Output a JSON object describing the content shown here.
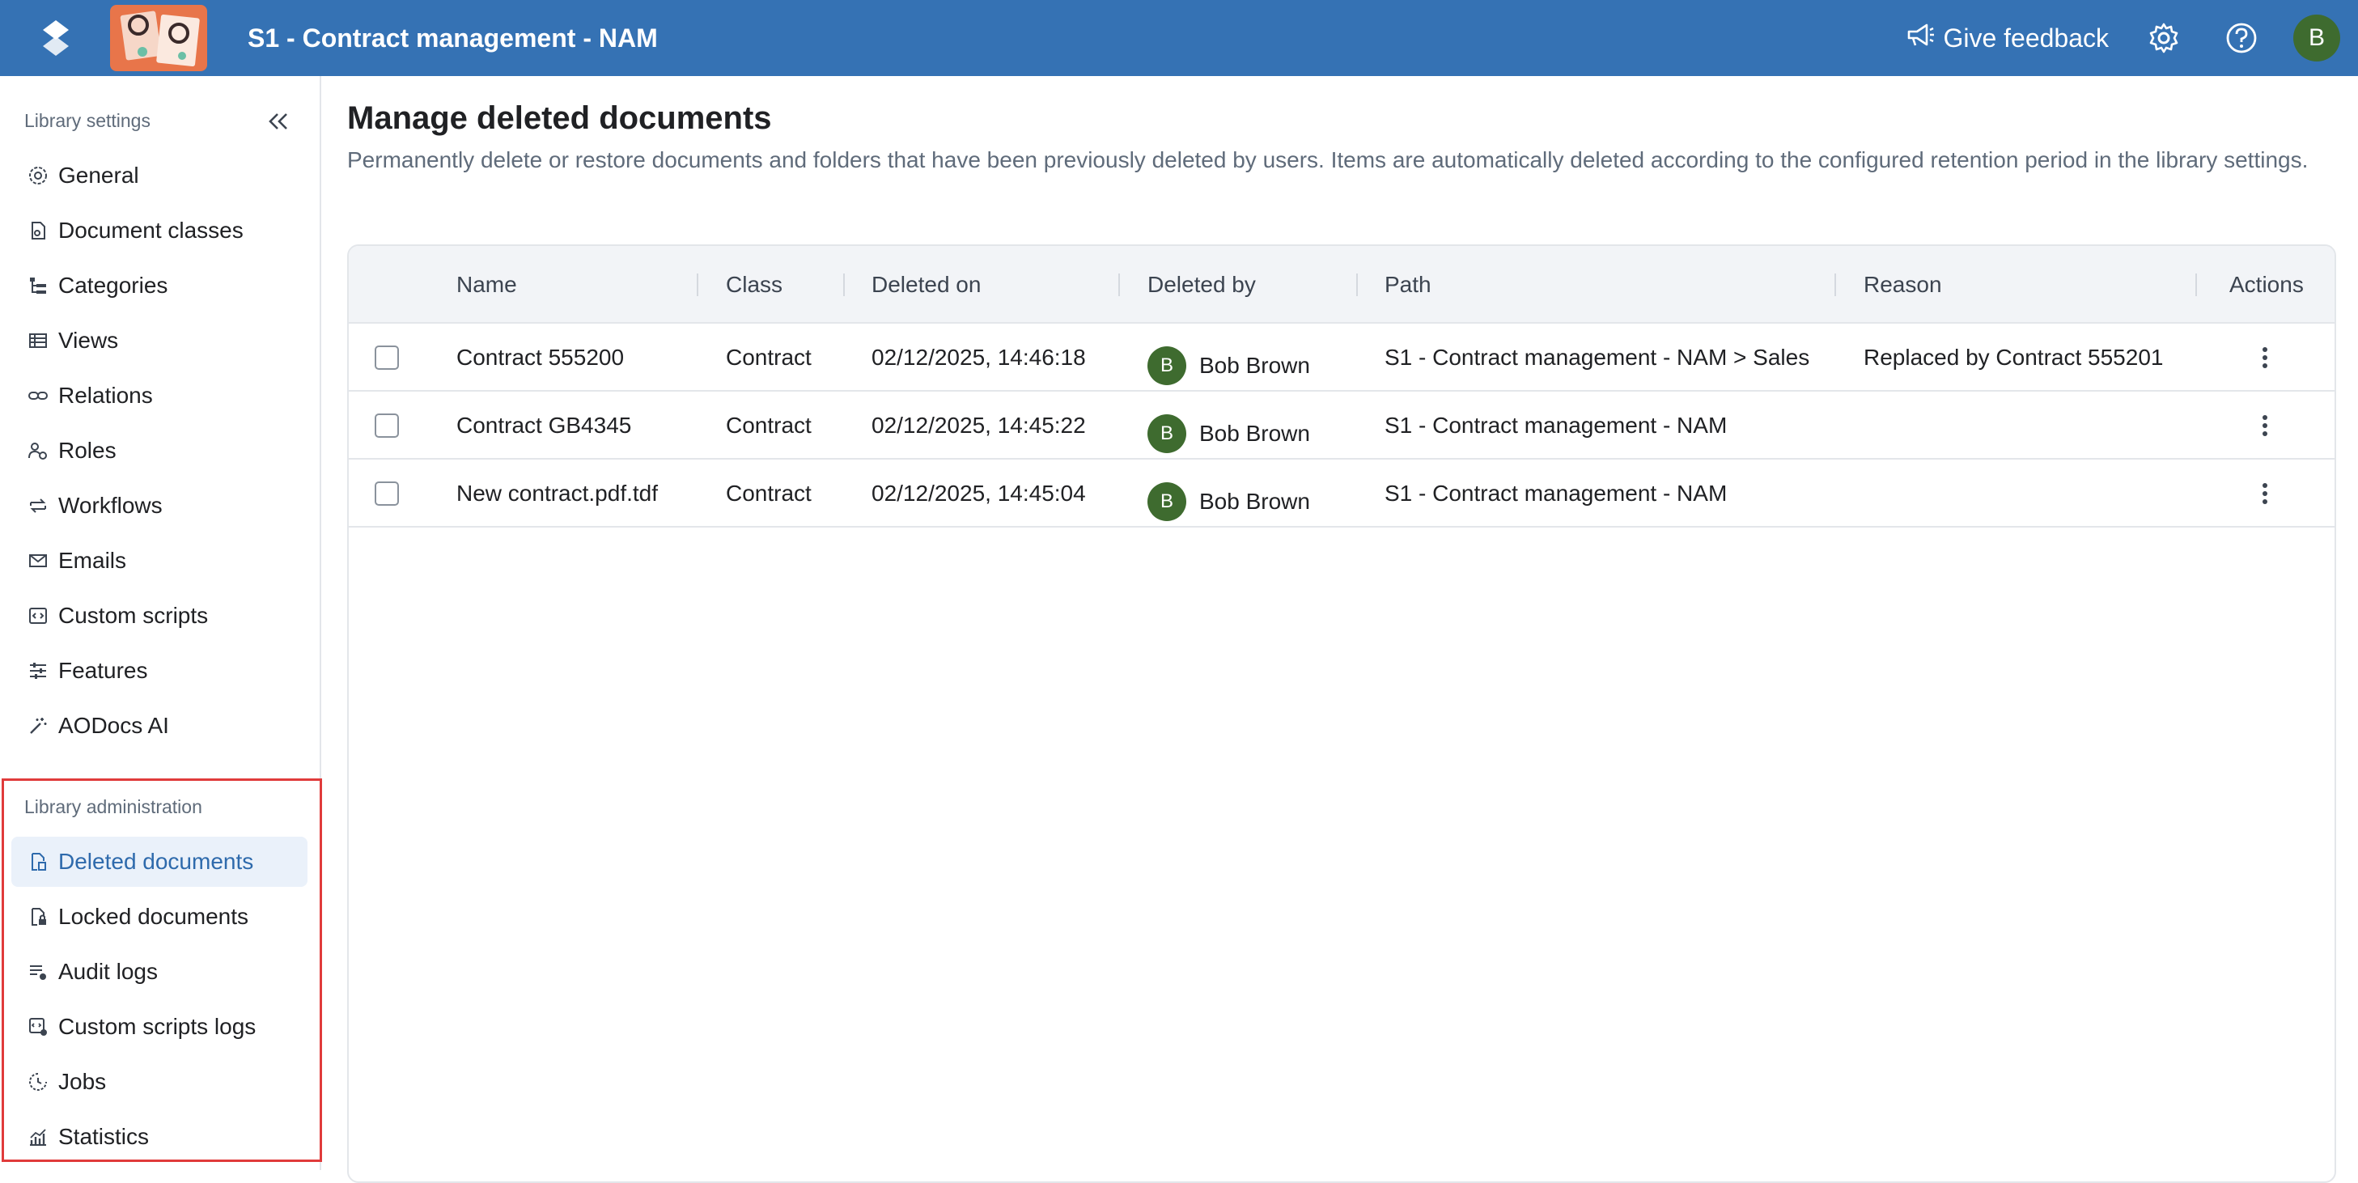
{
  "header": {
    "app_title": "S1 - Contract management - NAM",
    "feedback_label": "Give feedback",
    "user_initial": "B",
    "brand_color": "#3572b4"
  },
  "sidebar": {
    "settings_heading": "Library settings",
    "settings_items": [
      {
        "label": "General",
        "icon": "gear-icon"
      },
      {
        "label": "Document classes",
        "icon": "document-class-icon"
      },
      {
        "label": "Categories",
        "icon": "categories-icon"
      },
      {
        "label": "Views",
        "icon": "views-icon"
      },
      {
        "label": "Relations",
        "icon": "link-icon"
      },
      {
        "label": "Roles",
        "icon": "roles-icon"
      },
      {
        "label": "Workflows",
        "icon": "workflow-icon"
      },
      {
        "label": "Emails",
        "icon": "mail-icon"
      },
      {
        "label": "Custom scripts",
        "icon": "code-icon"
      },
      {
        "label": "Features",
        "icon": "sliders-icon"
      },
      {
        "label": "AODocs AI",
        "icon": "magic-wand-icon"
      }
    ],
    "admin_heading": "Library administration",
    "admin_items": [
      {
        "label": "Deleted documents",
        "icon": "deleted-document-icon",
        "active": true
      },
      {
        "label": "Locked documents",
        "icon": "locked-document-icon"
      },
      {
        "label": "Audit logs",
        "icon": "audit-log-icon"
      },
      {
        "label": "Custom scripts logs",
        "icon": "script-log-icon"
      },
      {
        "label": "Jobs",
        "icon": "jobs-icon"
      },
      {
        "label": "Statistics",
        "icon": "statistics-icon"
      }
    ]
  },
  "main": {
    "title": "Manage deleted documents",
    "description": "Permanently delete or restore documents and folders that have been previously deleted by users. Items are automatically deleted according to the configured retention period in the library settings.",
    "columns": [
      "Name",
      "Class",
      "Deleted on",
      "Deleted by",
      "Path",
      "Reason",
      "Actions"
    ],
    "rows": [
      {
        "name": "Contract 555200",
        "class": "Contract",
        "deleted_on": "02/12/2025, 14:46:18",
        "avatar": "B",
        "deleted_by": "Bob Brown",
        "path": "S1 - Contract management - NAM > Sales",
        "reason": "Replaced by Contract 555201"
      },
      {
        "name": "Contract GB4345",
        "class": "Contract",
        "deleted_on": "02/12/2025, 14:45:22",
        "avatar": "B",
        "deleted_by": "Bob Brown",
        "path": "S1 - Contract management - NAM",
        "reason": ""
      },
      {
        "name": "New contract.pdf.tdf",
        "class": "Contract",
        "deleted_on": "02/12/2025, 14:45:04",
        "avatar": "B",
        "deleted_by": "Bob Brown",
        "path": "S1 - Contract management - NAM",
        "reason": ""
      }
    ]
  }
}
